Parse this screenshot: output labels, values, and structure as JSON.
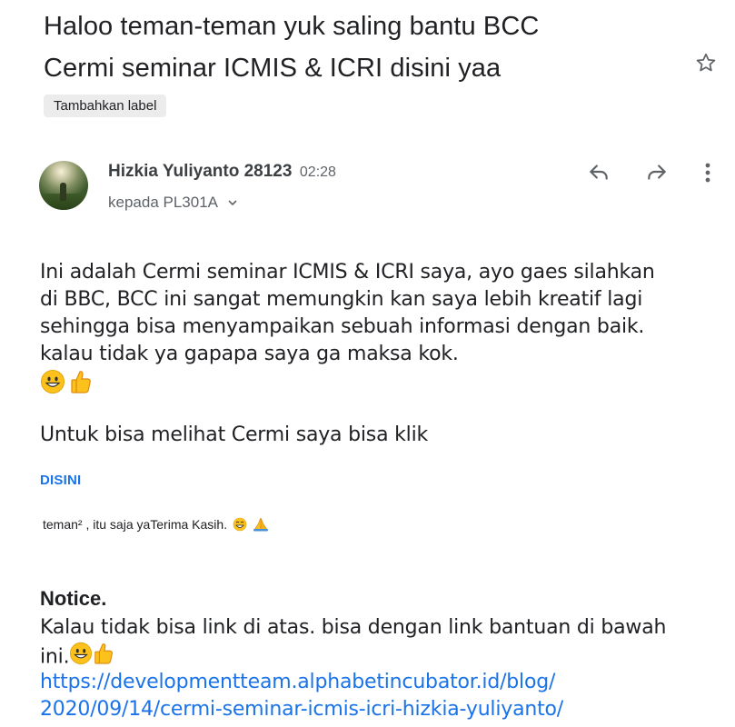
{
  "subject": {
    "line1": "Haloo teman-teman yuk saling bantu BCC",
    "line2": "Cermi seminar ICMIS & ICRI disini yaa"
  },
  "label_chip": "Tambahkan label",
  "sender": {
    "name": "Hizkia Yuliyanto 28123",
    "time": "02:28",
    "recipient": "kepada PL301A"
  },
  "actions": {
    "reply_icon": "reply-icon",
    "forward_icon": "forward-icon",
    "more_icon": "more-vert-icon",
    "star_icon": "star-outline-icon"
  },
  "body": {
    "para1": [
      "Ini adalah Cermi seminar ICMIS & ICRI saya, ayo gaes silahkan",
      "di BBC, BCC ini sangat memungkin kan saya lebih kreatif lagi",
      "sehingga bisa menyampaikan sebuah informasi dengan baik.",
      "kalau tidak ya gapapa saya ga maksa kok."
    ],
    "para2": "Untuk bisa melihat Cermi saya bisa klik",
    "link_label": "DISINI",
    "small_line": "teman² , itu saja yaTerima Kasih."
  },
  "notice": {
    "title": "Notice.",
    "text_line1": "Kalau tidak bisa link di atas. bisa dengan link bantuan di bawah",
    "text_line2": "ini.",
    "url_line1": "https://developmentteam.alphabetincubator.id/blog/",
    "url_line2": "2020/09/14/cermi-seminar-icmis-icri-hizkia-yuliyanto/"
  },
  "colors": {
    "link": "#1a73e8",
    "text": "#202124",
    "secondary": "#5f6368",
    "chip_bg": "#ececec"
  }
}
